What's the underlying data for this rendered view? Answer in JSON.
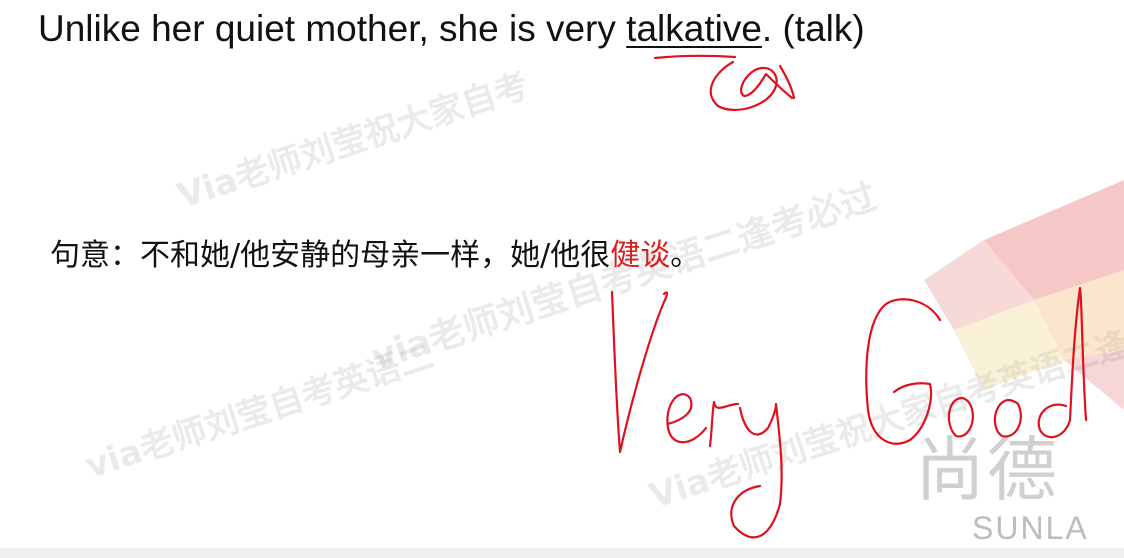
{
  "sentence": {
    "before": "Unlike her quiet mother, she is ",
    "word_very": "very",
    "space": " ",
    "answer": "talkative",
    "after": ". (talk)"
  },
  "meaning": {
    "prefix": "句意：不和她/他安静的母亲一样，她/他很",
    "highlight": "健谈",
    "suffix": "。"
  },
  "watermarks": [
    "Via老师刘莹祝大家自考",
    "via老师刘莹自考英语二逢考必过",
    "via老师刘莹自考英语二",
    "Via老师刘莹祝大家自考英语二逢考必过"
  ],
  "logo": {
    "name": "尚德",
    "sub": "SUNLA"
  },
  "handwriting": {
    "text": "Very Good"
  },
  "colors": {
    "ink": "#e01020",
    "highlight": "#d82020",
    "text": "#111111"
  }
}
